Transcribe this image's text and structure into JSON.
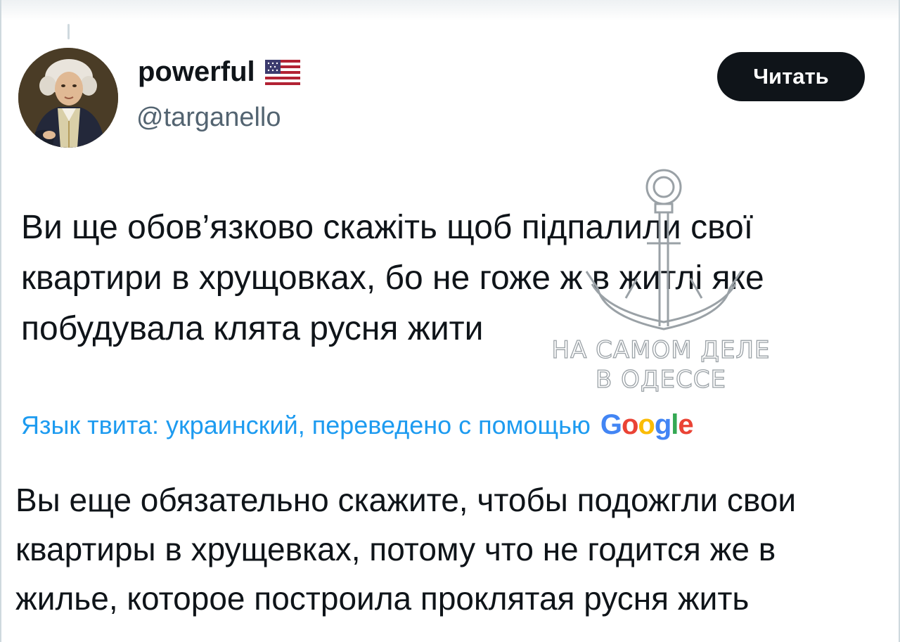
{
  "tweet": {
    "display_name": "powerful",
    "flag_icon": "us-flag-icon",
    "handle": "@targanello",
    "follow_label": "Читать",
    "original_lines": [
      "Ви ще обов’язково скажіть щоб підпалили свої",
      "квартири в хрущовках, бо не гоже ж в житлі яке",
      "побудувала клята русня жити"
    ],
    "translation_note": "Язык твита: украинский, переведено с помощью",
    "translation_provider": "Google",
    "translated_lines": [
      "Вы еще обязательно скажите, чтобы подожгли свои",
      "квартиры в хрущевках, потому что не годится же в",
      "жилье, которое построила проклятая русня жить"
    ]
  },
  "watermark": {
    "icon": "anchor-icon",
    "line1": "НА САМОМ ДЕЛЕ",
    "line2": "В ОДЕССЕ"
  },
  "colors": {
    "text": "#0f1419",
    "secondary": "#536471",
    "link": "#1d9bf0",
    "button_bg": "#0f1419",
    "button_text": "#ffffff"
  }
}
